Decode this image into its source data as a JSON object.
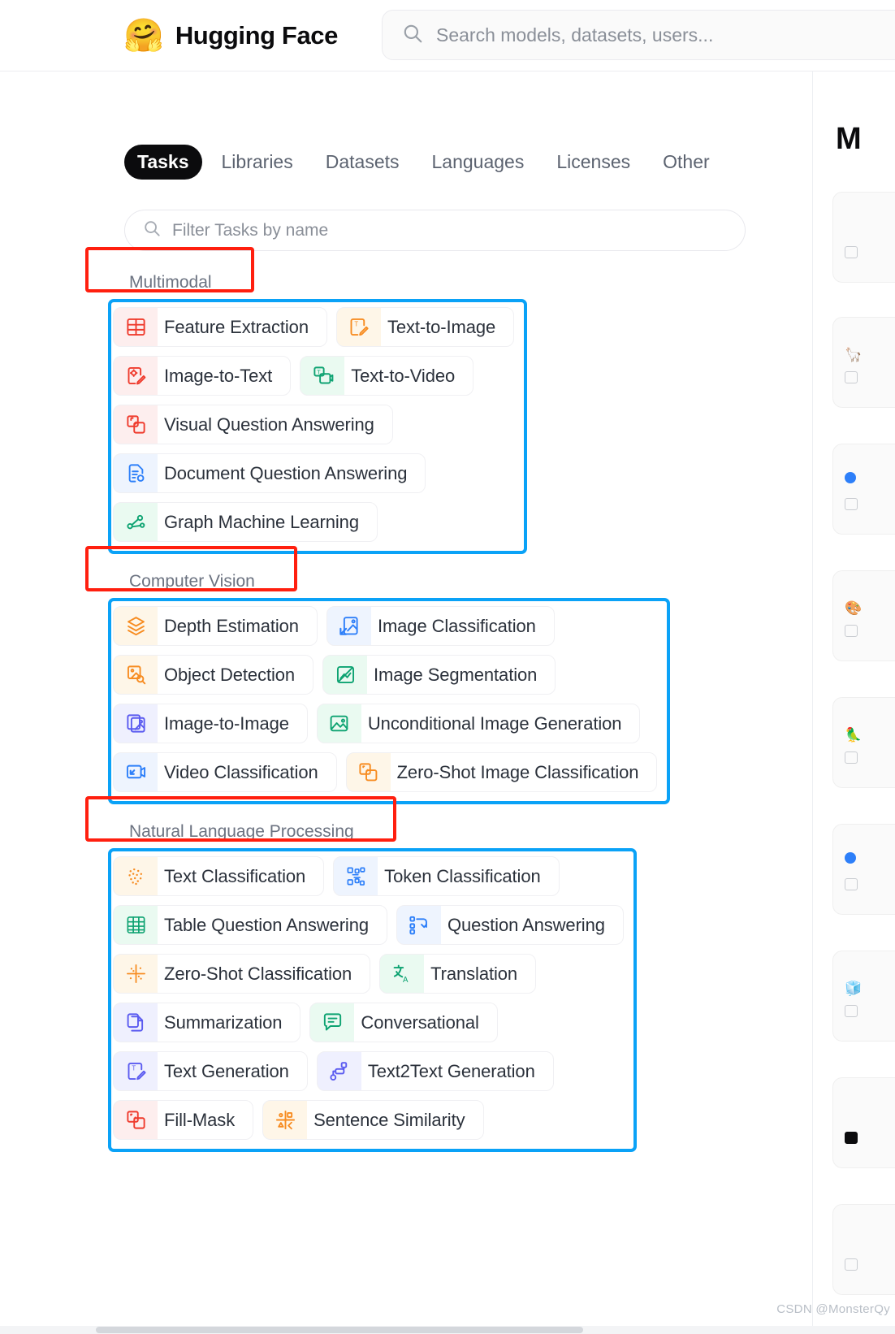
{
  "header": {
    "logo_emoji": "🤗",
    "brand_name": "Hugging Face",
    "search_placeholder": "Search models, datasets, users...",
    "search_icon": "search-icon"
  },
  "tabs": [
    {
      "label": "Tasks",
      "active": true
    },
    {
      "label": "Libraries",
      "active": false
    },
    {
      "label": "Datasets",
      "active": false
    },
    {
      "label": "Languages",
      "active": false
    },
    {
      "label": "Licenses",
      "active": false
    },
    {
      "label": "Other",
      "active": false
    }
  ],
  "filter": {
    "placeholder": "Filter Tasks by name",
    "value": "",
    "icon": "search-icon"
  },
  "colors": {
    "annotation_red": "#ff1f0f",
    "annotation_blue": "#0aa2f7",
    "active_tab_bg": "#0b0b0d",
    "text_primary": "#2b313b",
    "text_muted": "#6b7280",
    "icon_red": "#ef3b2d",
    "icon_orange": "#f78c21",
    "icon_green": "#0ea372",
    "icon_blue": "#2d7ff9",
    "icon_indigo": "#5b5bf0"
  },
  "groups": [
    {
      "title": "Multimodal",
      "rows": [
        [
          {
            "label": "Feature Extraction",
            "icon": "table-grid-icon",
            "color": "red"
          },
          {
            "label": "Text-to-Image",
            "icon": "text-pencil-icon",
            "color": "orange"
          }
        ],
        [
          {
            "label": "Image-to-Text",
            "icon": "image-pencil-icon",
            "color": "red"
          },
          {
            "label": "Text-to-Video",
            "icon": "video-frames-icon",
            "color": "green"
          }
        ],
        [
          {
            "label": "Visual Question Answering",
            "icon": "visual-qa-icon",
            "color": "red"
          }
        ],
        [
          {
            "label": "Document Question Answering",
            "icon": "document-qa-icon",
            "color": "blue"
          }
        ],
        [
          {
            "label": "Graph Machine Learning",
            "icon": "graph-nodes-icon",
            "color": "green"
          }
        ]
      ]
    },
    {
      "title": "Computer Vision",
      "rows": [
        [
          {
            "label": "Depth Estimation",
            "icon": "layers-diamond-icon",
            "color": "orange"
          },
          {
            "label": "Image Classification",
            "icon": "image-arrow-icon",
            "color": "blue"
          }
        ],
        [
          {
            "label": "Object Detection",
            "icon": "object-box-icon",
            "color": "orange"
          },
          {
            "label": "Image Segmentation",
            "icon": "segment-icon",
            "color": "green"
          }
        ],
        [
          {
            "label": "Image-to-Image",
            "icon": "image-stack-icon",
            "color": "indigo"
          },
          {
            "label": "Unconditional Image Generation",
            "icon": "picture-icon",
            "color": "green"
          }
        ],
        [
          {
            "label": "Video Classification",
            "icon": "video-arrow-icon",
            "color": "blue"
          },
          {
            "label": "Zero-Shot Image Classification",
            "icon": "zeroshot-image-icon",
            "color": "orange"
          }
        ]
      ]
    },
    {
      "title": "Natural Language Processing",
      "rows": [
        [
          {
            "label": "Text Classification",
            "icon": "dots-scatter-icon",
            "color": "orange"
          },
          {
            "label": "Token Classification",
            "icon": "token-blocks-icon",
            "color": "blue"
          }
        ],
        [
          {
            "label": "Table Question Answering",
            "icon": "table-icon",
            "color": "green"
          },
          {
            "label": "Question Answering",
            "icon": "qa-arrow-icon",
            "color": "blue"
          }
        ],
        [
          {
            "label": "Zero-Shot Classification",
            "icon": "zeroshot-dots-icon",
            "color": "orange"
          },
          {
            "label": "Translation",
            "icon": "translate-icon",
            "color": "green"
          }
        ],
        [
          {
            "label": "Summarization",
            "icon": "copy-doc-icon",
            "color": "indigo"
          },
          {
            "label": "Conversational",
            "icon": "chat-bubble-icon",
            "color": "green"
          }
        ],
        [
          {
            "label": "Text Generation",
            "icon": "text-pencil-icon",
            "color": "indigo"
          },
          {
            "label": "Text2Text Generation",
            "icon": "flow-nodes-icon",
            "color": "indigo"
          }
        ],
        [
          {
            "label": "Fill-Mask",
            "icon": "fill-mask-icon",
            "color": "red"
          },
          {
            "label": "Sentence Similarity",
            "icon": "similarity-icon",
            "color": "orange"
          }
        ]
      ]
    }
  ],
  "right_panel": {
    "heading": "M"
  },
  "watermark": "CSDN @MonsterQy"
}
